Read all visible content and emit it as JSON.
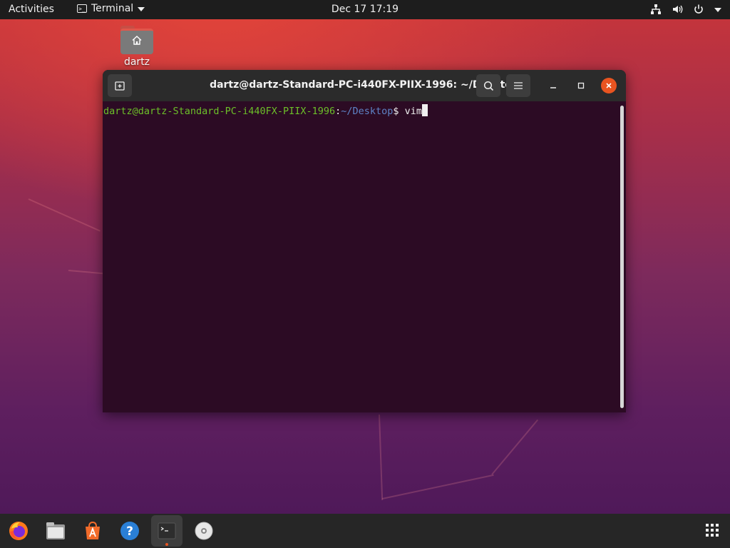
{
  "topbar": {
    "activities": "Activities",
    "app_name": "Terminal",
    "clock": "Dec 17  17:19",
    "tray_icons": [
      "network-icon",
      "volume-icon",
      "power-icon",
      "tray-menu-caret-icon"
    ]
  },
  "desktop": {
    "icons": [
      {
        "label": "dartz",
        "icon": "home-folder-icon"
      }
    ]
  },
  "terminal": {
    "title": "dartz@dartz-Standard-PC-i440FX-PIIX-1996: ~/Desktop",
    "prompt_user_host": "dartz@dartz-Standard-PC-i440FX-PIIX-1996",
    "prompt_sep": ":",
    "prompt_path": "~/Desktop",
    "prompt_symbol": "$ ",
    "command": "vim",
    "buttons": [
      "new-tab-icon",
      "search-icon",
      "hamburger-menu-icon",
      "minimize-icon",
      "maximize-icon",
      "close-icon"
    ]
  },
  "dock": {
    "items": [
      {
        "name": "firefox",
        "icon": "firefox-icon",
        "active": false
      },
      {
        "name": "files",
        "icon": "files-icon",
        "active": false
      },
      {
        "name": "software",
        "icon": "software-center-icon",
        "active": false
      },
      {
        "name": "help",
        "icon": "help-icon",
        "active": false
      },
      {
        "name": "terminal",
        "icon": "terminal-icon",
        "active": true
      },
      {
        "name": "disc",
        "icon": "optical-disc-icon",
        "active": false
      }
    ],
    "show_apps_icon": "app-grid-icon"
  },
  "colors": {
    "accent": "#e95420",
    "terminal_bg": "#2c0b24",
    "prompt_user": "#6cbf29",
    "prompt_path": "#5e83c6"
  }
}
